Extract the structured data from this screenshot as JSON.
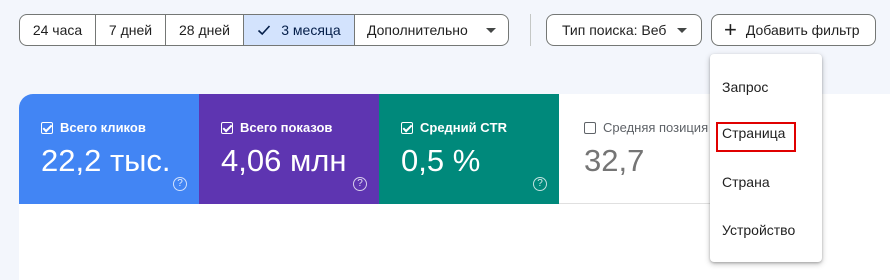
{
  "date_range": {
    "options": [
      "24 часа",
      "7 дней",
      "28 дней",
      "3 месяца"
    ],
    "selected": "3 месяца",
    "more_label": "Дополнительно"
  },
  "filters": {
    "search_type_label": "Тип поиска: Веб",
    "add_filter_label": "Добавить фильтр"
  },
  "metrics": [
    {
      "label": "Всего кликов",
      "value": "22,2 тыс.",
      "checked": true,
      "color": "#4285f4"
    },
    {
      "label": "Всего показов",
      "value": "4,06 млн",
      "checked": true,
      "color": "#5e35b1"
    },
    {
      "label": "Средний CTR",
      "value": "0,5 %",
      "checked": true,
      "color": "#00897b"
    },
    {
      "label": "Средняя позиция",
      "value": "32,7",
      "checked": false,
      "color": "#ffffff"
    }
  ],
  "filter_menu": {
    "items": [
      "Запрос",
      "Страница",
      "Страна",
      "Устройство"
    ],
    "highlighted": "Страница",
    "highlight_color": "#e00000"
  },
  "icons": {
    "check": "check-icon",
    "dropdown": "caret-down-icon",
    "add": "plus-icon",
    "help": "help-icon"
  }
}
